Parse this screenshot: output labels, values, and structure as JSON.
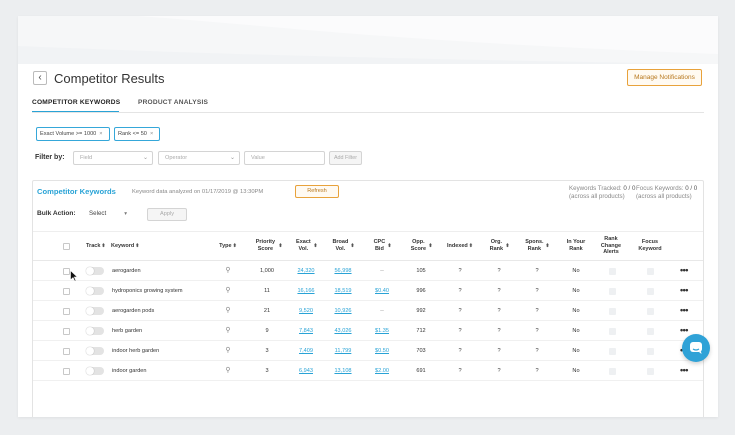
{
  "header": {
    "back_glyph": "‹",
    "title": "Competitor Results",
    "manage_label": "Manage Notifications"
  },
  "tabs": [
    {
      "label": "COMPETITOR KEYWORDS",
      "active": true
    },
    {
      "label": "PRODUCT ANALYSIS",
      "active": false
    }
  ],
  "chips": [
    {
      "label": "Exact Volume >= 1000"
    },
    {
      "label": "Rank <= 50"
    }
  ],
  "chip_close": "×",
  "filter": {
    "label": "Filter by:",
    "field_placeholder": "Field",
    "operator_placeholder": "Operator",
    "value_placeholder": "Value",
    "add_label": "Add Filter"
  },
  "panel": {
    "title": "Competitor Keywords",
    "analyzed": "Keyword data analyzed on 01/17/2019 @ 13:30PM",
    "refresh_label": "Refresh",
    "tracked_label": "Keywords Tracked:",
    "tracked_value": "0 / 0",
    "tracked_note": "(across all products)",
    "focus_label": "Focus Keywords:",
    "focus_value": "0 / 0",
    "focus_note": "(across all products)",
    "bulk_label": "Bulk Action:",
    "bulk_value": "Select",
    "apply_label": "Apply"
  },
  "columns": {
    "track": "Track",
    "keyword": "Keyword",
    "type": "Type",
    "priority": "Priority Score",
    "exact": "Exact Vol.",
    "broad": "Broad Vol.",
    "cpc": "CPC Bid",
    "opp": "Opp. Score",
    "indexed": "Indexed",
    "org": "Org. Rank",
    "spons": "Spons. Rank",
    "inrank": "In Your Rank",
    "alerts": "Rank Change Alerts",
    "focus": "Focus Keyword"
  },
  "sort_glyph": "⬍",
  "rows": [
    {
      "keyword": "aerogarden",
      "priority": "1,000",
      "exact": "24,320",
      "broad": "56,998",
      "cpc": "--",
      "opp": "105",
      "indexed": "?",
      "org": "?",
      "spons": "?",
      "inrank": "No"
    },
    {
      "keyword": "hydroponics growing system",
      "priority": "11",
      "exact": "16,166",
      "broad": "18,519",
      "cpc": "$0.40",
      "opp": "996",
      "indexed": "?",
      "org": "?",
      "spons": "?",
      "inrank": "No"
    },
    {
      "keyword": "aerogarden pods",
      "priority": "21",
      "exact": "9,520",
      "broad": "10,926",
      "cpc": "--",
      "opp": "992",
      "indexed": "?",
      "org": "?",
      "spons": "?",
      "inrank": "No"
    },
    {
      "keyword": "herb garden",
      "priority": "9",
      "exact": "7,843",
      "broad": "43,026",
      "cpc": "$1.35",
      "opp": "712",
      "indexed": "?",
      "org": "?",
      "spons": "?",
      "inrank": "No"
    },
    {
      "keyword": "indoor herb garden",
      "priority": "3",
      "exact": "7,409",
      "broad": "11,799",
      "cpc": "$0.50",
      "opp": "703",
      "indexed": "?",
      "org": "?",
      "spons": "?",
      "inrank": "No"
    },
    {
      "keyword": "indoor garden",
      "priority": "3",
      "exact": "6,943",
      "broad": "13,108",
      "cpc": "$2.00",
      "opp": "691",
      "indexed": "?",
      "org": "?",
      "spons": "?",
      "inrank": "No"
    }
  ],
  "more_glyph": "•••",
  "colors": {
    "accent": "#29a3d6",
    "orange": "#e8a23b",
    "chat": "#2fa2d7"
  },
  "icons": {
    "type": "pin-icon",
    "chat": "chat-bubble-icon",
    "back": "chevron-left-icon"
  }
}
